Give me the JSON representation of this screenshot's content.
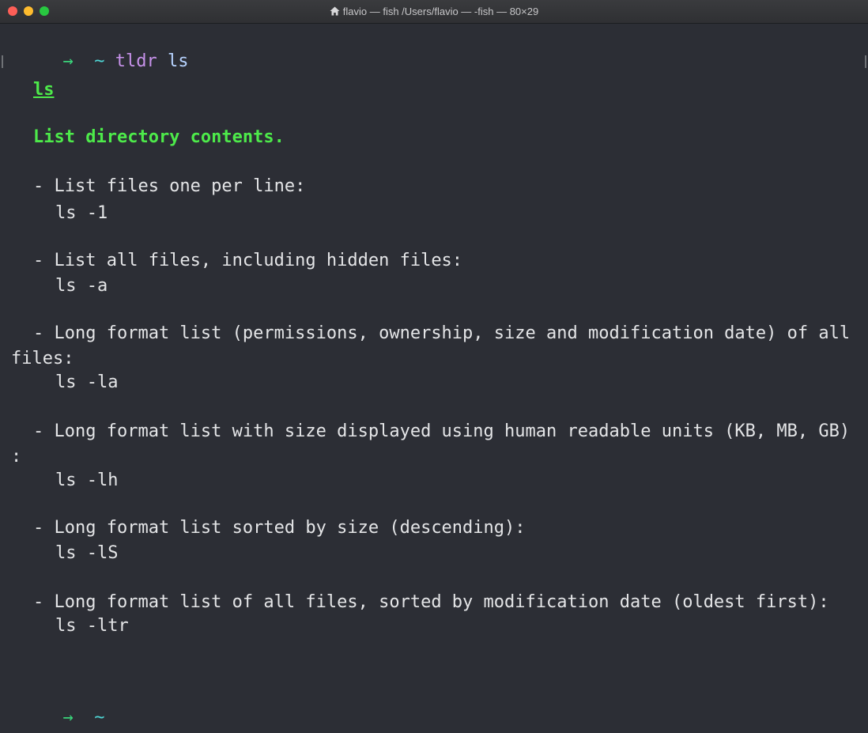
{
  "window": {
    "title": "flavio — fish /Users/flavio — -fish — 80×29"
  },
  "prompt1": {
    "arrow": "→",
    "cwd": "~",
    "command": "tldr",
    "argument": "ls"
  },
  "page": {
    "name": "ls",
    "description": "List directory contents."
  },
  "examples": [
    {
      "desc": "- List files one per line:",
      "cmd": "ls -1"
    },
    {
      "desc": "- List all files, including hidden files:",
      "cmd": "ls -a"
    },
    {
      "desc_line1": "- Long format list (permissions, ownership, size and modification date) of all",
      "desc_line2": "files:",
      "cmd": "ls -la"
    },
    {
      "desc_line1": "- Long format list with size displayed using human readable units (KB, MB, GB)",
      "desc_line2": ":",
      "cmd": "ls -lh"
    },
    {
      "desc": "- Long format list sorted by size (descending):",
      "cmd": "ls -lS"
    },
    {
      "desc": "- Long format list of all files, sorted by modification date (oldest first):",
      "cmd": "ls -ltr"
    }
  ],
  "prompt2": {
    "arrow": "→",
    "cwd": "~"
  },
  "colors": {
    "background": "#2c2e35",
    "green_heading": "#4dea4a",
    "arrow": "#3ad47a",
    "cwd": "#4fd7d6",
    "command": "#c792ea"
  }
}
